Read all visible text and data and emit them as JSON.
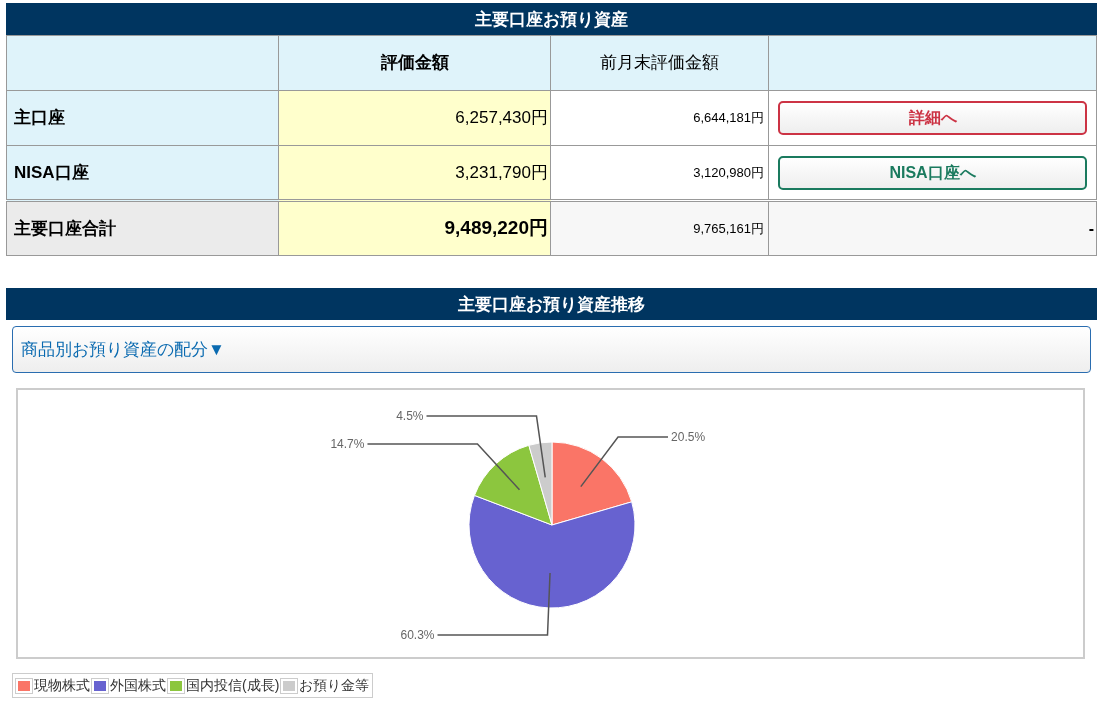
{
  "assets": {
    "title": "主要口座お預り資産",
    "columns": [
      "",
      "評価金額",
      "前月末評価金額",
      ""
    ],
    "rows": [
      {
        "kind": "account",
        "label": "主口座",
        "value": "6,257,430円",
        "previous": "6,644,181円",
        "action": {
          "label": "詳細へ",
          "color": "#cc3344"
        }
      },
      {
        "kind": "account",
        "label": "NISA口座",
        "value": "3,231,790円",
        "previous": "3,120,980円",
        "action": {
          "label": "NISA口座へ",
          "color": "#1a7a5e"
        }
      },
      {
        "kind": "total",
        "label": "主要口座合計",
        "value": "9,489,220円",
        "previous": "9,765,161円",
        "action_text": "-"
      }
    ]
  },
  "trend": {
    "title": "主要口座お預り資産推移",
    "accordion": {
      "label": "商品別お預り資産の配分▼"
    },
    "chart_data": {
      "type": "pie",
      "categories": [
        "現物株式",
        "外国株式",
        "国内投信(成長)",
        "お預り金等"
      ],
      "values": [
        20.5,
        60.3,
        14.7,
        4.5
      ],
      "colors": [
        "#fa7567",
        "#6762d0",
        "#8cc63e",
        "#cccccc"
      ],
      "value_labels": [
        "20.5%",
        "60.3%",
        "14.7%",
        "4.5%"
      ]
    }
  }
}
